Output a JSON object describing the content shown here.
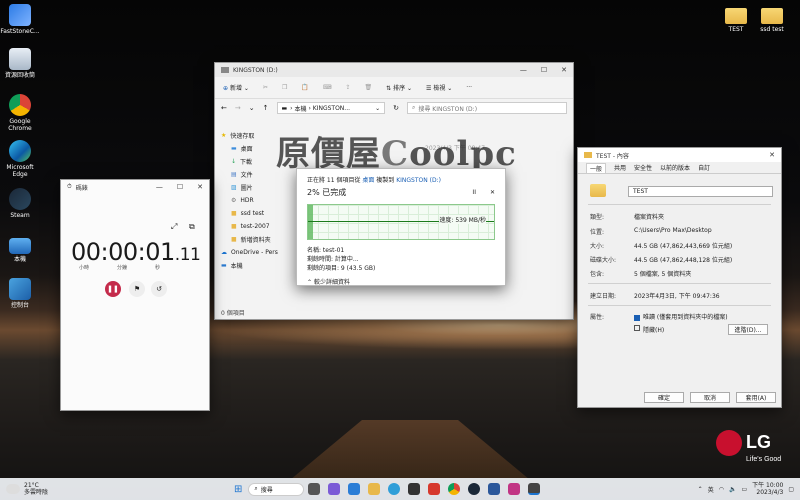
{
  "desktop": {
    "icons_left": [
      {
        "label": "FastStoneC...",
        "type": "app"
      },
      {
        "label": "資源回收筒",
        "type": "recycle"
      },
      {
        "label": "Google Chrome",
        "type": "chrome"
      },
      {
        "label": "Microsoft Edge",
        "type": "edge"
      },
      {
        "label": "Steam",
        "type": "steam"
      },
      {
        "label": "本機",
        "type": "pc"
      },
      {
        "label": "控制台",
        "type": "control"
      }
    ],
    "icons_right": [
      {
        "label": "TEST"
      },
      {
        "label": "ssd test"
      }
    ]
  },
  "explorer": {
    "title": "KINGSTON (D:)",
    "toolbar": {
      "new": "新增",
      "sort": "排序",
      "view": "檢視"
    },
    "address": {
      "pc": "本機",
      "sep": "›",
      "drive": "KINGSTON..."
    },
    "search_placeholder": "搜尋 KINGSTON (D:)",
    "date_fragment": "2023/4/3 下午 09:47",
    "sidebar": [
      {
        "label": "快速存取",
        "icon": "star-icon"
      },
      {
        "label": "桌面",
        "icon": "desktop-icon"
      },
      {
        "label": "下載",
        "icon": "download-icon"
      },
      {
        "label": "文件",
        "icon": "document-icon"
      },
      {
        "label": "圖片",
        "icon": "picture-icon"
      },
      {
        "label": "HDR",
        "icon": "folder-icon"
      },
      {
        "label": "ssd test",
        "icon": "folder-icon"
      },
      {
        "label": "test-2007",
        "icon": "folder-icon"
      },
      {
        "label": "新増資料夾",
        "icon": "folder-icon"
      },
      {
        "label": "OneDrive - Pers",
        "icon": "cloud-icon"
      },
      {
        "label": "本機",
        "icon": "pc-icon"
      }
    ],
    "status": "0 個項目"
  },
  "copy_dialog": {
    "line1_prefix": "正在將 11 個項目從 ",
    "line1_from": "桌面",
    "line1_mid": " 複製到 ",
    "line1_to": "KINGSTON (D:)",
    "percent_label": "2% 已完成",
    "progress": 0.02,
    "speed": "速度: 539 MB/秒",
    "name_label": "名稱: test-01",
    "remaining_time": "剩餘時間: 計算中...",
    "remaining_items": "剩餘的項目: 9 (43.5 GB)",
    "less_details": "較少詳細資料",
    "pause": "II",
    "close": "✕"
  },
  "watermark": {
    "text1": "原價屋",
    "text2": "C",
    "text3": "oolpc"
  },
  "stopwatch": {
    "title": "碼錶",
    "time_main": "00:00:01",
    "time_frac": ".11",
    "label_h": "小時",
    "label_m": "分鐘",
    "label_s": "秒"
  },
  "properties": {
    "title": "TEST - 內容",
    "tabs": [
      "一般",
      "共用",
      "安全性",
      "以前的版本",
      "自訂"
    ],
    "folder_name": "TEST",
    "rows": [
      {
        "k": "類型:",
        "v": "檔案資料夾"
      },
      {
        "k": "位置:",
        "v": "C:\\Users\\Pro Max\\Desktop"
      },
      {
        "k": "大小:",
        "v": "44.5 GB (47,862,443,669 位元組)"
      },
      {
        "k": "磁碟大小:",
        "v": "44.5 GB (47,862,448,128 位元組)"
      },
      {
        "k": "包含:",
        "v": "5 個檔案, 5 個資料夾"
      },
      {
        "k": "建立日期:",
        "v": "2023年4月3日, 下午 09:47:36"
      },
      {
        "k": "屬性:",
        "v": "唯讀 (僅套用到資料夾中的檔案)"
      }
    ],
    "hidden_label": "隱藏(H)",
    "advanced": "進階(D)...",
    "ok": "確定",
    "cancel": "取消",
    "apply": "套用(A)"
  },
  "taskbar": {
    "weather_temp": "21°C",
    "weather_desc": "多雲時陰",
    "search": "搜尋",
    "lang": "英",
    "time": "下午 10:00",
    "date": "2023/4/3"
  },
  "brand": {
    "logo": "LG",
    "slogan": "Life's Good"
  },
  "colors": {
    "accent": "#1a5fb4",
    "progress": "#5cb85c",
    "lg_red": "#c8102e",
    "stop_red": "#c42b4b"
  }
}
